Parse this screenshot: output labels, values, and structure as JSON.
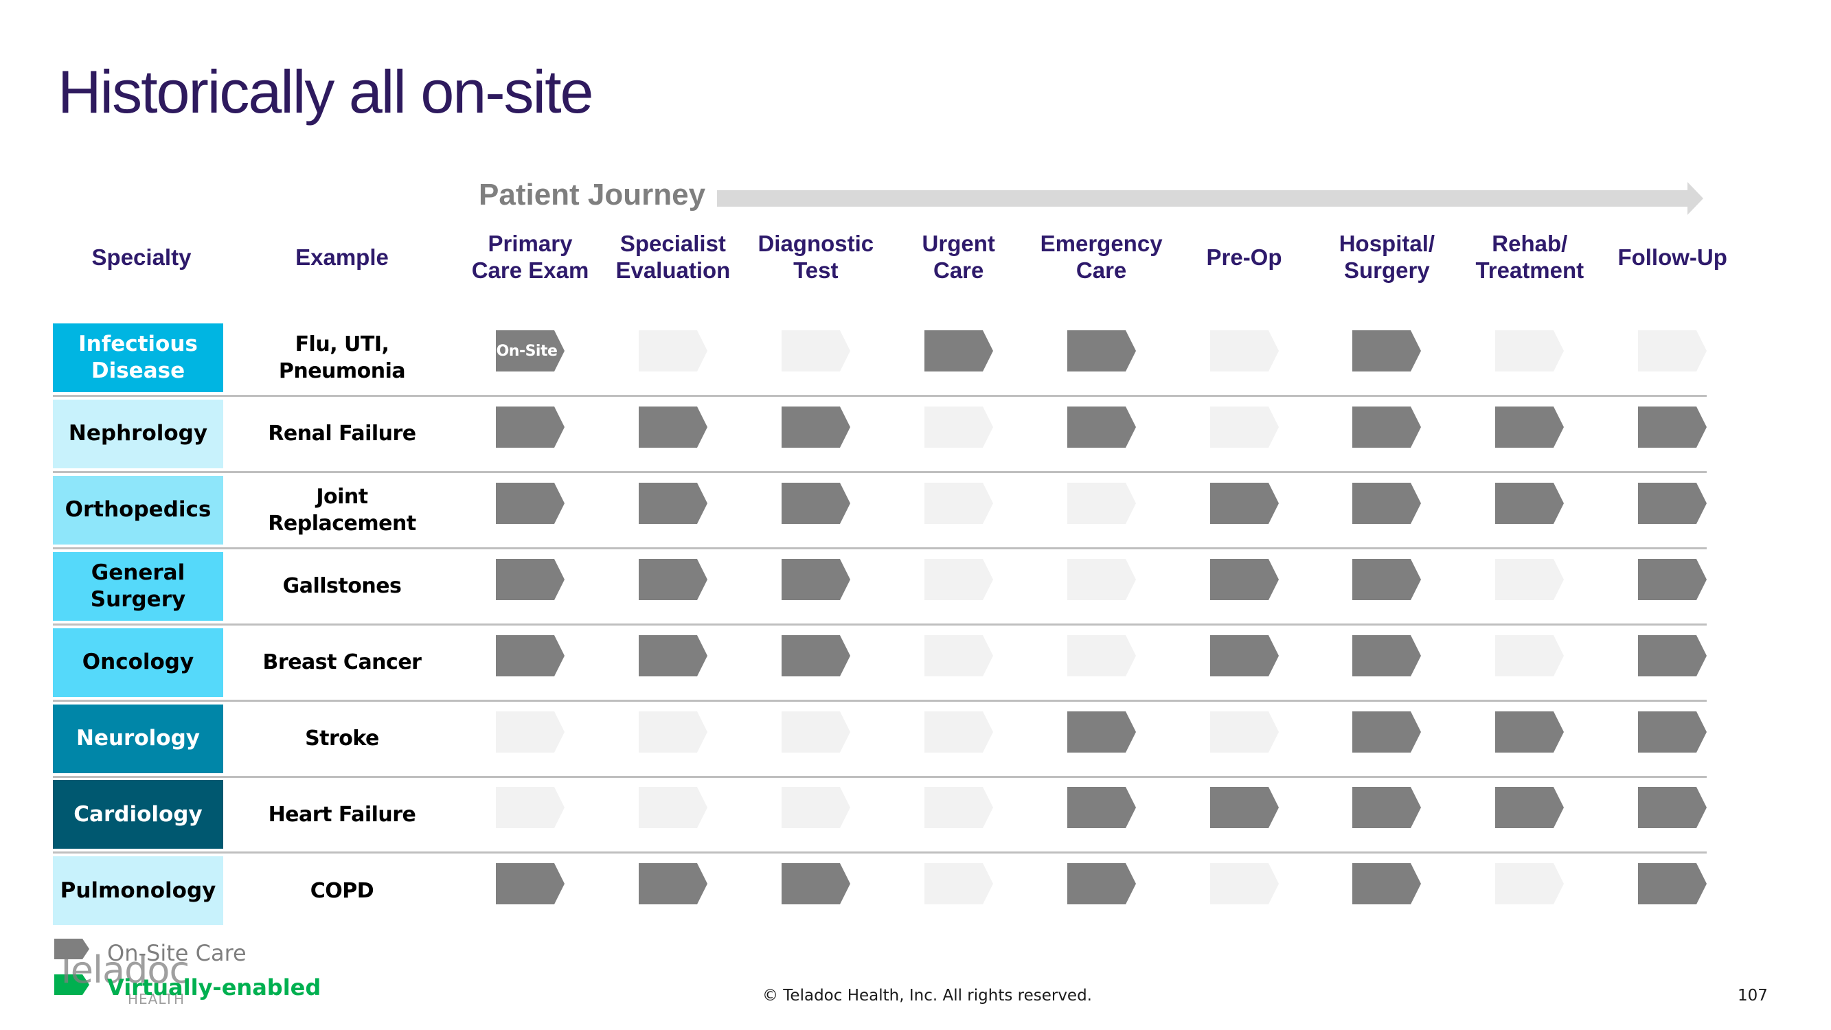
{
  "slide": {
    "title": "Historically all on-site",
    "journey_label": "Patient Journey",
    "footer": "© Teladoc Health, Inc. All rights reserved.",
    "page_number": "107"
  },
  "colors": {
    "title": "#2E1A5E",
    "header_text": "#2E1A6B",
    "on_site": "#7F7F7F",
    "not_applicable": "#F2F2F2",
    "virtually_enabled": "#00B050",
    "journey_arrow": "#D9D9D9",
    "divider": "#BFBFBF"
  },
  "headers": {
    "specialty": "Specialty",
    "example": "Example",
    "stages": [
      "Primary\nCare Exam",
      "Specialist\nEvaluation",
      "Diagnostic\nTest",
      "Urgent\nCare",
      "Emergency\nCare",
      "Pre-Op",
      "Hospital/\nSurgery",
      "Rehab/\nTreatment",
      "Follow-Up"
    ]
  },
  "rows": [
    {
      "specialty": "Infectious\nDisease",
      "example": "Flu, UTI,\nPneumonia",
      "box_color": "#00B5E2",
      "text_color": "#FFFFFF",
      "stages": [
        "on-site",
        "none",
        "none",
        "on-site",
        "on-site",
        "none",
        "on-site",
        "none",
        "none"
      ]
    },
    {
      "specialty": "Nephrology",
      "example": "Renal Failure",
      "box_color": "#C8F2FC",
      "text_color": "#000000",
      "stages": [
        "on-site",
        "on-site",
        "on-site",
        "none",
        "on-site",
        "none",
        "on-site",
        "on-site",
        "on-site"
      ]
    },
    {
      "specialty": "Orthopedics",
      "example": "Joint\nReplacement",
      "box_color": "#8EE6FA",
      "text_color": "#000000",
      "stages": [
        "on-site",
        "on-site",
        "on-site",
        "none",
        "none",
        "on-site",
        "on-site",
        "on-site",
        "on-site"
      ]
    },
    {
      "specialty": "General\nSurgery",
      "example": "Gallstones",
      "box_color": "#55D9FA",
      "text_color": "#000000",
      "stages": [
        "on-site",
        "on-site",
        "on-site",
        "none",
        "none",
        "on-site",
        "on-site",
        "none",
        "on-site"
      ]
    },
    {
      "specialty": "Oncology",
      "example": "Breast Cancer",
      "box_color": "#55D9FA",
      "text_color": "#000000",
      "stages": [
        "on-site",
        "on-site",
        "on-site",
        "none",
        "none",
        "on-site",
        "on-site",
        "none",
        "on-site"
      ]
    },
    {
      "specialty": "Neurology",
      "example": "Stroke",
      "box_color": "#0086A8",
      "text_color": "#FFFFFF",
      "stages": [
        "none",
        "none",
        "none",
        "none",
        "on-site",
        "none",
        "on-site",
        "on-site",
        "on-site"
      ]
    },
    {
      "specialty": "Cardiology",
      "example": "Heart Failure",
      "box_color": "#005870",
      "text_color": "#FFFFFF",
      "stages": [
        "none",
        "none",
        "none",
        "none",
        "on-site",
        "on-site",
        "on-site",
        "on-site",
        "on-site"
      ]
    },
    {
      "specialty": "Pulmonology",
      "example": "COPD",
      "box_color": "#C8F2FC",
      "text_color": "#000000",
      "stages": [
        "on-site",
        "on-site",
        "on-site",
        "none",
        "on-site",
        "none",
        "on-site",
        "none",
        "on-site"
      ]
    }
  ],
  "first_cell_label": "On-Site",
  "legend": {
    "on_site": "On-Site Care",
    "virtual": "Virtually-enabled"
  },
  "logo": {
    "name": "Teladoc",
    "sub": "HEALTH"
  }
}
